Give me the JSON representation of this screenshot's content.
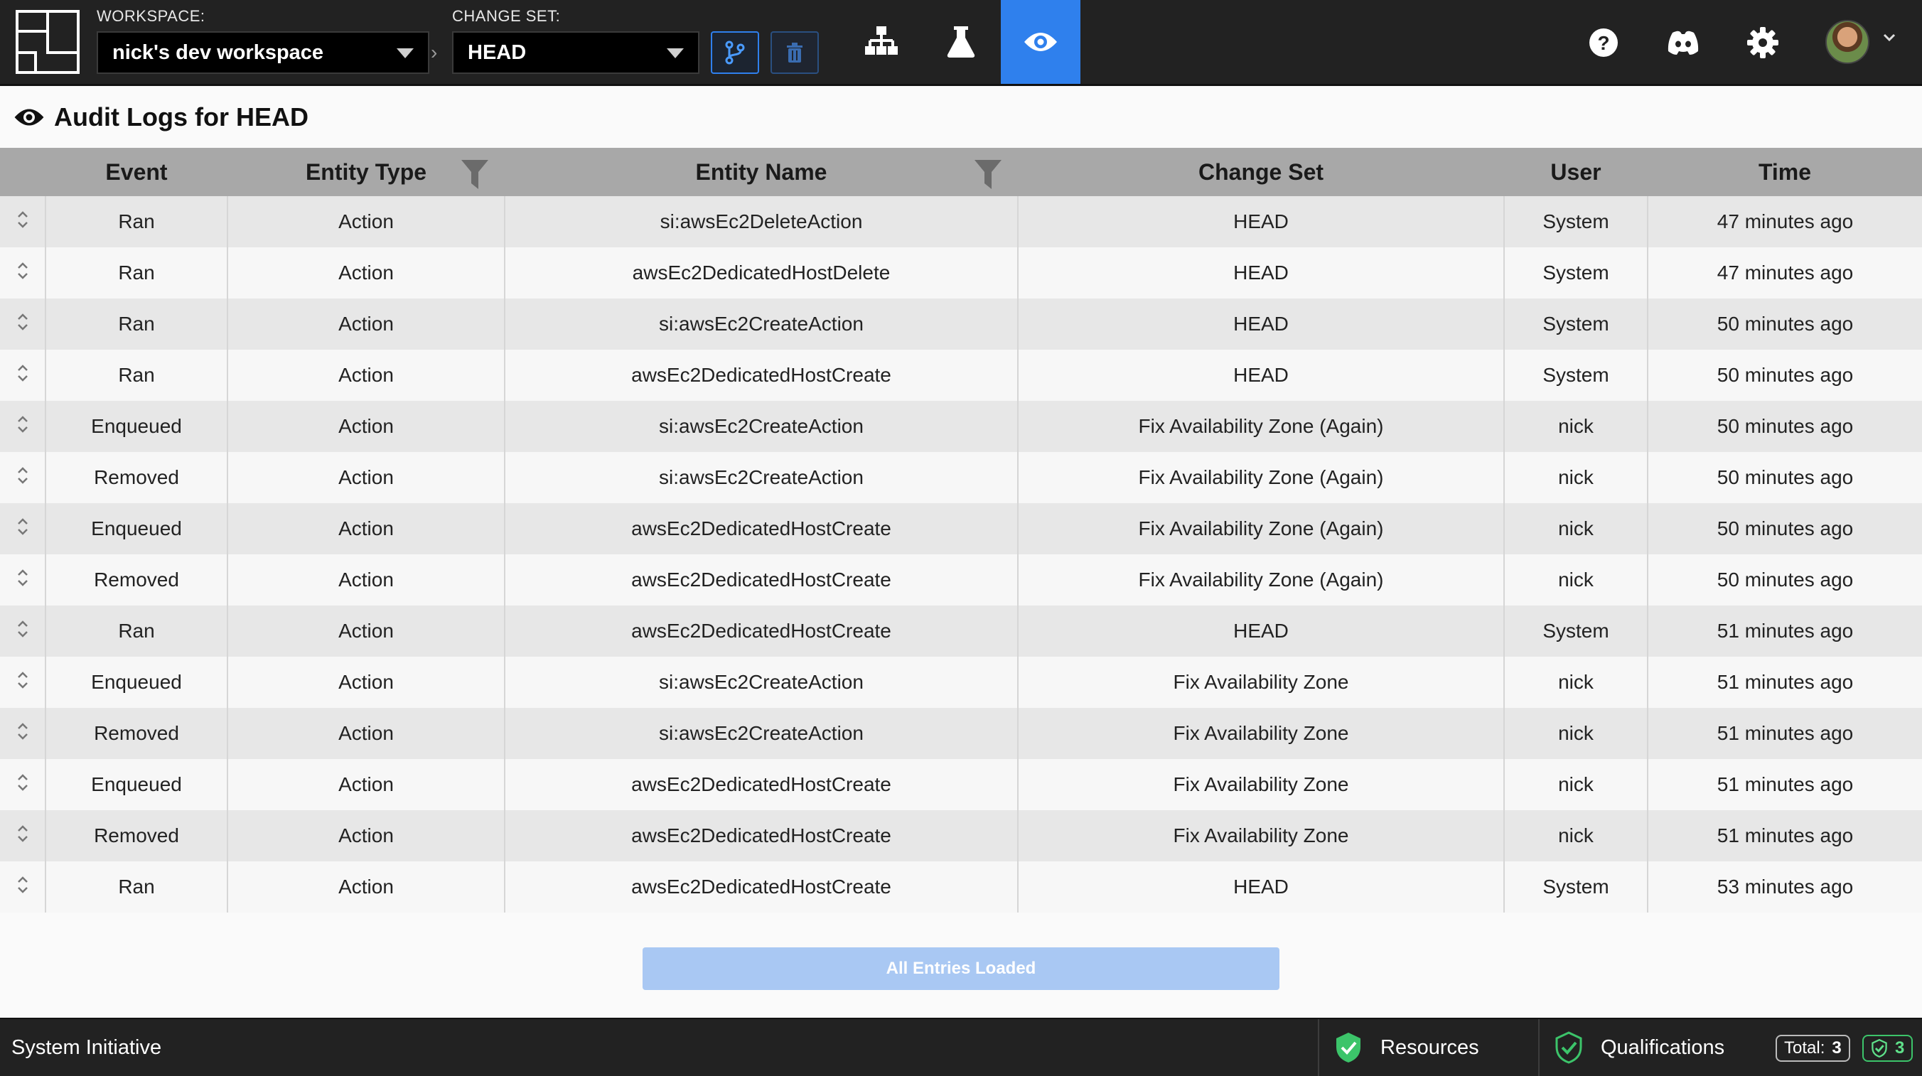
{
  "header": {
    "workspace_label": "WORKSPACE:",
    "workspace_value": "nick's dev workspace",
    "changeset_label": "CHANGE SET:",
    "changeset_value": "HEAD",
    "active_color": "#2f80ed"
  },
  "page": {
    "title": "Audit Logs for HEAD"
  },
  "table": {
    "columns": [
      "",
      "Event",
      "Entity Type",
      "Entity Name",
      "Change Set",
      "User",
      "Time"
    ],
    "rows": [
      {
        "event": "Ran",
        "entity_type": "Action",
        "entity_name": "si:awsEc2DeleteAction",
        "change_set": "HEAD",
        "user": "System",
        "time": "47 minutes ago"
      },
      {
        "event": "Ran",
        "entity_type": "Action",
        "entity_name": "awsEc2DedicatedHostDelete",
        "change_set": "HEAD",
        "user": "System",
        "time": "47 minutes ago"
      },
      {
        "event": "Ran",
        "entity_type": "Action",
        "entity_name": "si:awsEc2CreateAction",
        "change_set": "HEAD",
        "user": "System",
        "time": "50 minutes ago"
      },
      {
        "event": "Ran",
        "entity_type": "Action",
        "entity_name": "awsEc2DedicatedHostCreate",
        "change_set": "HEAD",
        "user": "System",
        "time": "50 minutes ago"
      },
      {
        "event": "Enqueued",
        "entity_type": "Action",
        "entity_name": "si:awsEc2CreateAction",
        "change_set": "Fix Availability Zone (Again)",
        "user": "nick",
        "time": "50 minutes ago"
      },
      {
        "event": "Removed",
        "entity_type": "Action",
        "entity_name": "si:awsEc2CreateAction",
        "change_set": "Fix Availability Zone (Again)",
        "user": "nick",
        "time": "50 minutes ago"
      },
      {
        "event": "Enqueued",
        "entity_type": "Action",
        "entity_name": "awsEc2DedicatedHostCreate",
        "change_set": "Fix Availability Zone (Again)",
        "user": "nick",
        "time": "50 minutes ago"
      },
      {
        "event": "Removed",
        "entity_type": "Action",
        "entity_name": "awsEc2DedicatedHostCreate",
        "change_set": "Fix Availability Zone (Again)",
        "user": "nick",
        "time": "50 minutes ago"
      },
      {
        "event": "Ran",
        "entity_type": "Action",
        "entity_name": "awsEc2DedicatedHostCreate",
        "change_set": "HEAD",
        "user": "System",
        "time": "51 minutes ago"
      },
      {
        "event": "Enqueued",
        "entity_type": "Action",
        "entity_name": "si:awsEc2CreateAction",
        "change_set": "Fix Availability Zone",
        "user": "nick",
        "time": "51 minutes ago"
      },
      {
        "event": "Removed",
        "entity_type": "Action",
        "entity_name": "si:awsEc2CreateAction",
        "change_set": "Fix Availability Zone",
        "user": "nick",
        "time": "51 minutes ago"
      },
      {
        "event": "Enqueued",
        "entity_type": "Action",
        "entity_name": "awsEc2DedicatedHostCreate",
        "change_set": "Fix Availability Zone",
        "user": "nick",
        "time": "51 minutes ago"
      },
      {
        "event": "Removed",
        "entity_type": "Action",
        "entity_name": "awsEc2DedicatedHostCreate",
        "change_set": "Fix Availability Zone",
        "user": "nick",
        "time": "51 minutes ago"
      },
      {
        "event": "Ran",
        "entity_type": "Action",
        "entity_name": "awsEc2DedicatedHostCreate",
        "change_set": "HEAD",
        "user": "System",
        "time": "53 minutes ago"
      }
    ]
  },
  "footer_button": {
    "label": "All Entries Loaded"
  },
  "statusbar": {
    "brand": "System Initiative",
    "resources_label": "Resources",
    "qualifications_label": "Qualifications",
    "total_label": "Total:",
    "total_value": "3",
    "ok_value": "3",
    "ok_color": "#3cc46a"
  },
  "icons": {
    "logo": "si-logo-icon",
    "branch": "branch-icon",
    "trash": "trash-icon",
    "diagram": "diagram-icon",
    "lab": "beaker-icon",
    "eye": "eye-icon",
    "help": "help-icon",
    "discord": "discord-icon",
    "settings": "gear-icon",
    "filter": "filter-icon",
    "expand": "expand-icon",
    "check": "check-shield-icon"
  }
}
